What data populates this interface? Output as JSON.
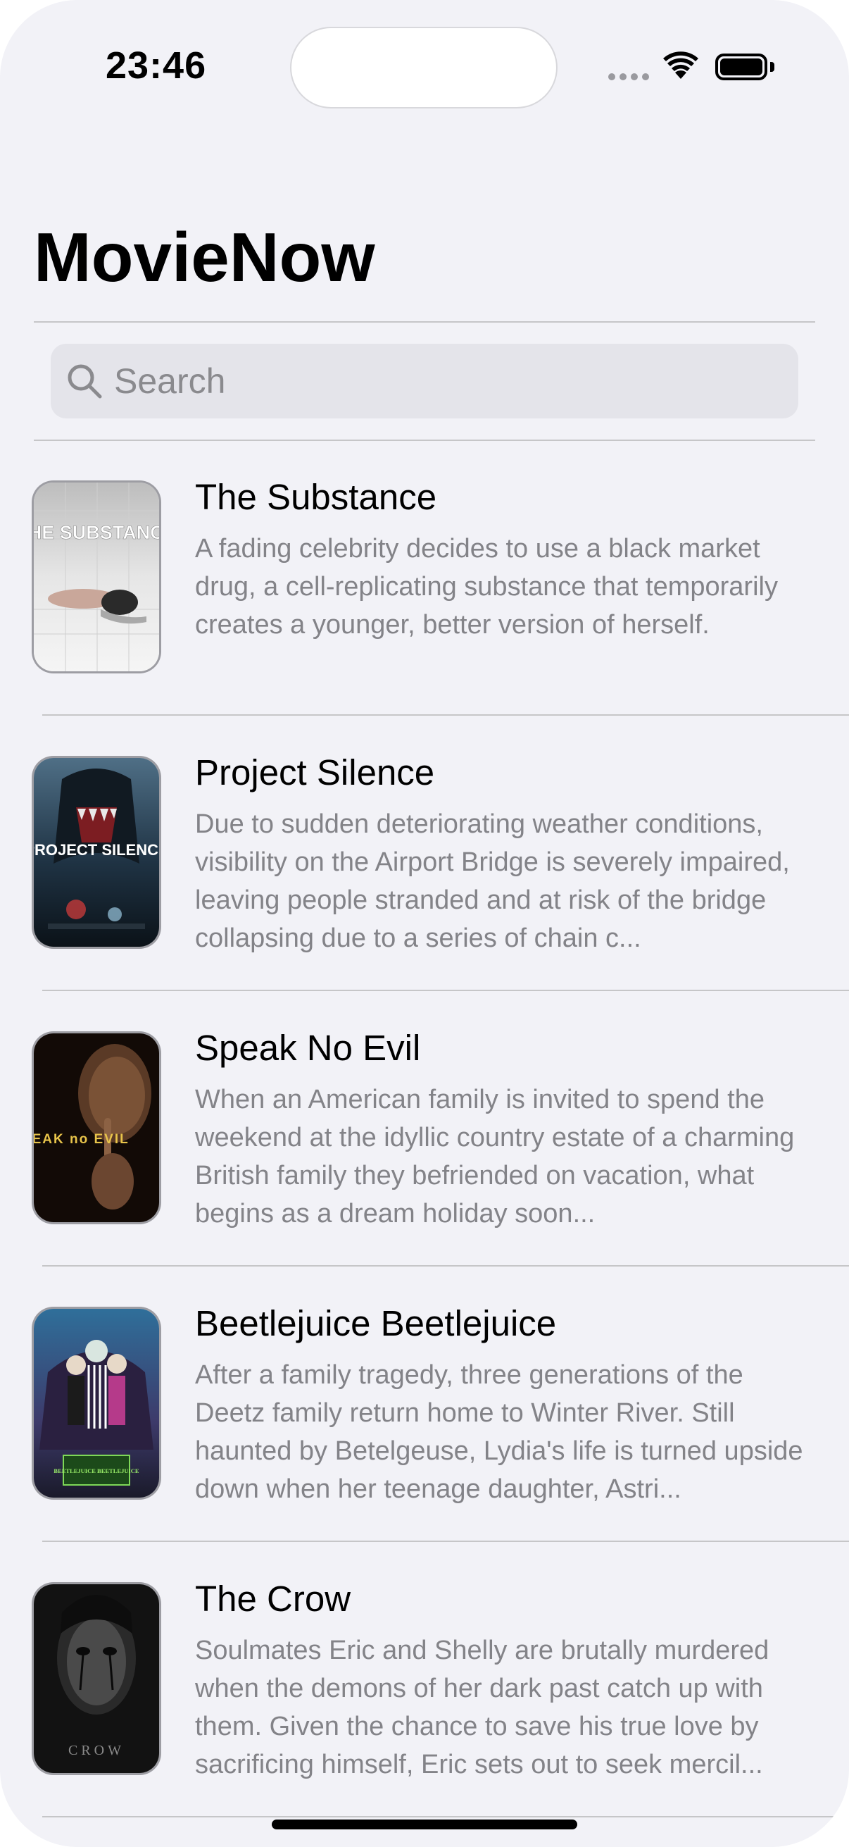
{
  "status_bar": {
    "time": "23:46",
    "icons": [
      "cellular-signal-icon",
      "wifi-icon",
      "battery-icon"
    ]
  },
  "app": {
    "title": "MovieNow"
  },
  "search": {
    "placeholder": "Search",
    "value": ""
  },
  "movies": [
    {
      "title": "The Substance",
      "overview": "A fading celebrity decides to use a black market drug, a cell-replicating substance that temporarily creates a younger, better version of herself.",
      "poster_text": "THE SUBSTANCE"
    },
    {
      "title": "Project Silence",
      "overview": "Due to sudden deteriorating weather conditions, visibility on the Airport Bridge is severely impaired, leaving people stranded and at risk of the bridge collapsing due to a series of chain c...",
      "poster_text": "PROJECT SILENCE"
    },
    {
      "title": "Speak No Evil",
      "overview": "When an American family is invited to spend the weekend at the idyllic country estate of a charming British family they befriended on vacation, what begins as a dream holiday soon...",
      "poster_text": "SPEAK no EVIL"
    },
    {
      "title": "Beetlejuice Beetlejuice",
      "overview": "After a family tragedy, three generations of the Deetz family return home to Winter River. Still haunted by Betelgeuse, Lydia's life is turned upside down when her teenage daughter, Astri...",
      "poster_text": "BEETLEJUICE BEETLEJUICE"
    },
    {
      "title": "The Crow",
      "overview": "Soulmates Eric and Shelly are brutally murdered when the demons of her dark past catch up with them. Given the chance to save his true love by sacrificing himself, Eric sets out to seek mercil...",
      "poster_text": "CROW"
    }
  ],
  "colors": {
    "background": "#f2f2f7",
    "search_fill": "#e4e4ea",
    "secondary_text": "#838388",
    "separator": "#c6c6c8"
  }
}
